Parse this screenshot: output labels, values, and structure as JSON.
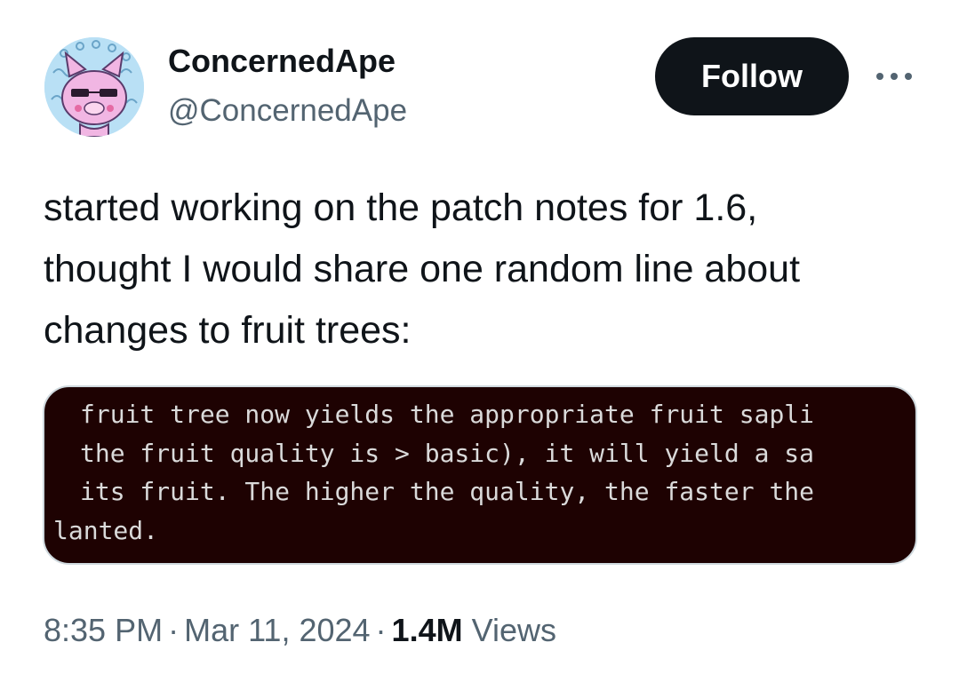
{
  "author": {
    "display_name": "ConcernedApe",
    "handle": "@ConcernedApe",
    "avatar_icon": "pink-cartoon-creature-avatar-icon"
  },
  "actions": {
    "follow_label": "Follow",
    "more_icon": "more-horizontal-icon"
  },
  "tweet": {
    "lines": [
      "started working on the patch notes for 1.6,",
      "thought I would share one random line about",
      "changes to fruit trees:"
    ]
  },
  "media": {
    "background_color": "#1e0202",
    "text_color": "#dadada",
    "lines": [
      "fruit tree now yields the appropriate fruit sapli",
      "the fruit quality is > basic), it will yield a sa",
      "its fruit. The higher the quality, the faster the",
      "lanted."
    ]
  },
  "meta": {
    "time": "8:35 PM",
    "date": "Mar 11, 2024",
    "separator": "·",
    "views_count": "1.4M",
    "views_label": "Views"
  }
}
